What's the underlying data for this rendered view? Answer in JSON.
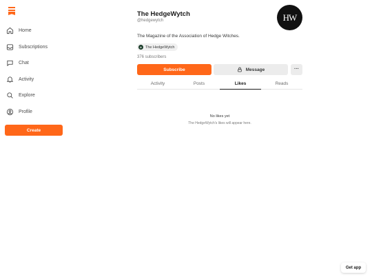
{
  "brand": {
    "accent": "#ff6719"
  },
  "sidebar": {
    "items": [
      {
        "label": "Home",
        "icon": "home-icon"
      },
      {
        "label": "Subscriptions",
        "icon": "inbox-icon"
      },
      {
        "label": "Chat",
        "icon": "chat-icon"
      },
      {
        "label": "Activity",
        "icon": "bell-icon"
      },
      {
        "label": "Explore",
        "icon": "search-icon"
      },
      {
        "label": "Profile",
        "icon": "user-icon"
      }
    ],
    "create_label": "Create"
  },
  "profile": {
    "name": "The HedgeWytch",
    "handle": "@hedgewytch",
    "avatar_text": "HW",
    "bio": "The Magazine of the Association of Hedge Witches.",
    "publication_chip": "The HedgeWytch",
    "subscribers": "376 subscribers"
  },
  "actions": {
    "subscribe_label": "Subscribe",
    "message_label": "Message",
    "more_label": "···"
  },
  "tabs": [
    {
      "label": "Activity",
      "active": false
    },
    {
      "label": "Posts",
      "active": false
    },
    {
      "label": "Likes",
      "active": true
    },
    {
      "label": "Reads",
      "active": false
    }
  ],
  "empty_state": {
    "title": "No likes yet",
    "subtitle": "The HedgeWytch's likes will appear here."
  },
  "footer": {
    "get_app_label": "Get app"
  }
}
